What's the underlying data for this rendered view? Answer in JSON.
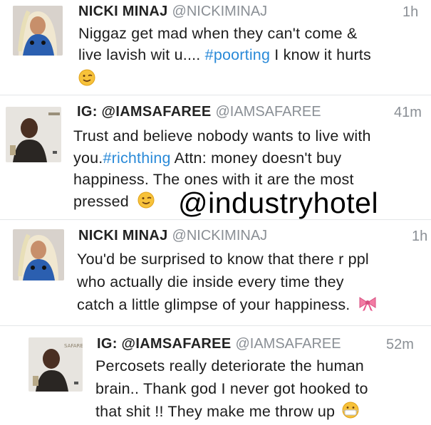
{
  "watermark": "@industryhotel",
  "tweets": [
    {
      "name": "NICKI MINAJ",
      "handle": "@NICKIMINAJ",
      "time": "1h",
      "lines": [
        {
          "pre": "Niggaz get mad when they can't come &",
          "tag": "",
          "post": ""
        },
        {
          "pre": "live lavish wit u.... ",
          "tag": "#poorting",
          "post": " I know it hurts"
        }
      ],
      "emoji": "winking-face"
    },
    {
      "name": "IG: @IAMSAFAREE",
      "handle": "@IAMSAFAREE",
      "time": "41m",
      "lines": [
        {
          "pre": "Trust and believe nobody wants to live with",
          "tag": "",
          "post": ""
        },
        {
          "pre": "you.",
          "tag": "#richthing",
          "post": " Attn: money doesn't buy"
        },
        {
          "pre": "happiness. The ones with it are the most",
          "tag": "",
          "post": ""
        },
        {
          "pre": "pressed",
          "tag": "",
          "post": ""
        }
      ],
      "emoji": "winking-face"
    },
    {
      "name": "NICKI MINAJ",
      "handle": "@NICKIMINAJ",
      "time": "1h",
      "lines": [
        {
          "pre": "You'd be surprised to know that there r ppl",
          "tag": "",
          "post": ""
        },
        {
          "pre": "who actually die inside every time they",
          "tag": "",
          "post": ""
        },
        {
          "pre": "catch a little glimpse of your happiness.",
          "tag": "",
          "post": ""
        }
      ],
      "emoji": "ribbon"
    },
    {
      "name": "IG: @IAMSAFAREE",
      "handle": "@IAMSAFAREE",
      "time": "52m",
      "lines": [
        {
          "pre": "Percosets really deteriorate the human",
          "tag": "",
          "post": ""
        },
        {
          "pre": "brain.. Thank god I never got hooked to",
          "tag": "",
          "post": ""
        },
        {
          "pre": "that shit !! They make me throw up",
          "tag": "",
          "post": ""
        }
      ],
      "emoji": "face-with-medical-mask",
      "album_cover_text": "SAFAREE"
    }
  ]
}
